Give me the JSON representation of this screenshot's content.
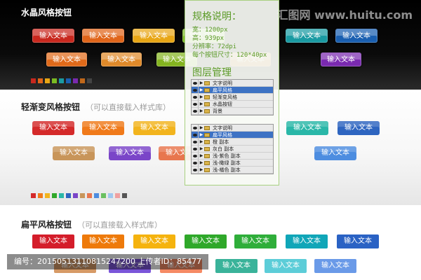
{
  "watermark": "汇图网 www.huitu.com",
  "sections": {
    "crystal": {
      "title": "水晶风格按钮"
    },
    "gradient": {
      "title": "轻渐变风格按钮",
      "subtitle": "（可以直接载入样式库）"
    },
    "flat": {
      "title": "扁平风格按钮",
      "subtitle": "（可以直接载入样式库）"
    }
  },
  "button_label": "输入文本",
  "colors": {
    "crystal_row1": [
      "#c8281e",
      "#e0651a",
      "#e8a615",
      "#7bbb22",
      "#1a9aa2",
      "#1a5fb0"
    ],
    "crystal_row2": [
      "#e06a1a",
      "#e08a2a",
      "#84b420",
      "#c0681a",
      "#7a2ab0"
    ],
    "gradient_row1": [
      "#d42a2a",
      "#f07a1a",
      "#f2b41e",
      "#2ab7a8",
      "#2e65c0"
    ],
    "gradient_row2": [
      "#c8955a",
      "#7a45c8",
      "#e8764e",
      "#4d8de0"
    ],
    "flat_row1": [
      "#d41d2a",
      "#ee7a0a",
      "#f5b30e",
      "#2fa82a",
      "#2fae3a",
      "#10a6b8",
      "#2a62c4"
    ],
    "flat_row2": [
      "#d69a66",
      "#7a55d8",
      "#f58a64",
      "#3ab39a",
      "#5ccdd8",
      "#6a9ae8"
    ],
    "swatches_dark": [
      "#c8281e",
      "#e0651a",
      "#e8a615",
      "#7bbb22",
      "#1a9aa2",
      "#1a5fb0",
      "#7a2ab0",
      "#c0681a",
      "#444444"
    ],
    "swatches_light": [
      "#d42a2a",
      "#f07a1a",
      "#f2b41e",
      "#2fa82a",
      "#2ab7a8",
      "#2e65c0",
      "#7a45c8",
      "#c8955a",
      "#e8764e",
      "#4d8de0",
      "#6ac060",
      "#a0c8ef",
      "#f0a0a0",
      "#555555"
    ]
  },
  "spec": {
    "title": "规格说明：",
    "lines": [
      "宽：1200px",
      "高：939px",
      "分辨率：72dpi",
      "每个按钮尺寸：120*40px"
    ]
  },
  "layers": {
    "title": "图层管理",
    "group1": [
      "文字说明",
      "扁平风格",
      "轻渐变风格",
      "水晶按钮",
      "背景"
    ],
    "group1_selected": 1,
    "group2": [
      "文字说明",
      "扁平风格",
      "橙 副本",
      "灰白 副本",
      "浅-紫色 副本",
      "浅-橄绿 副本",
      "浅-橘色 副本"
    ],
    "group2_selected": 1
  },
  "footer": "编号：20150513110815247200 上传者ID：85477"
}
